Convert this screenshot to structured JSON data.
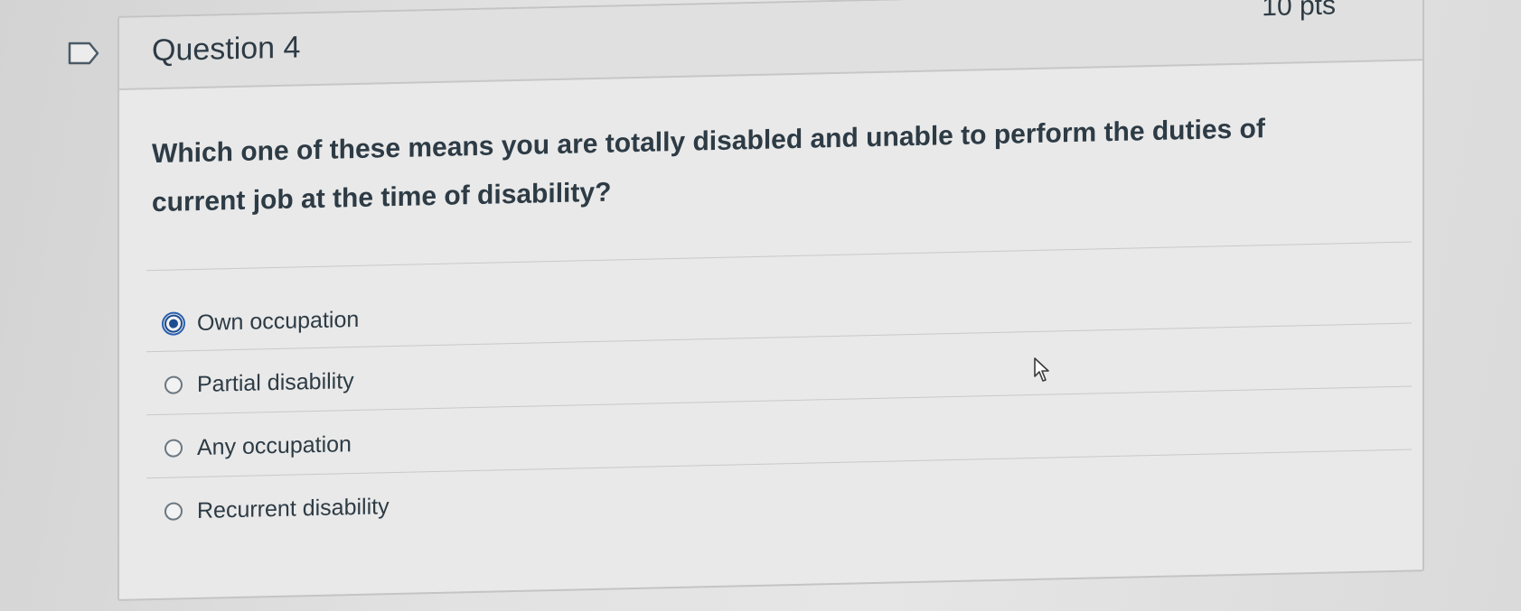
{
  "question": {
    "title": "Question 4",
    "points": "10 pts",
    "text": "Which one of these means you are totally disabled and unable to perform the duties of current job at the time of disability?",
    "answers": [
      {
        "label": "Own occupation",
        "selected": true
      },
      {
        "label": "Partial disability",
        "selected": false
      },
      {
        "label": "Any occupation",
        "selected": false
      },
      {
        "label": "Recurrent disability",
        "selected": false
      }
    ]
  },
  "icons": {
    "flag": "flag-question-icon",
    "cursor": "mouse-pointer-icon"
  },
  "colors": {
    "accent": "#1d4d8f",
    "text": "#2d3b45"
  }
}
